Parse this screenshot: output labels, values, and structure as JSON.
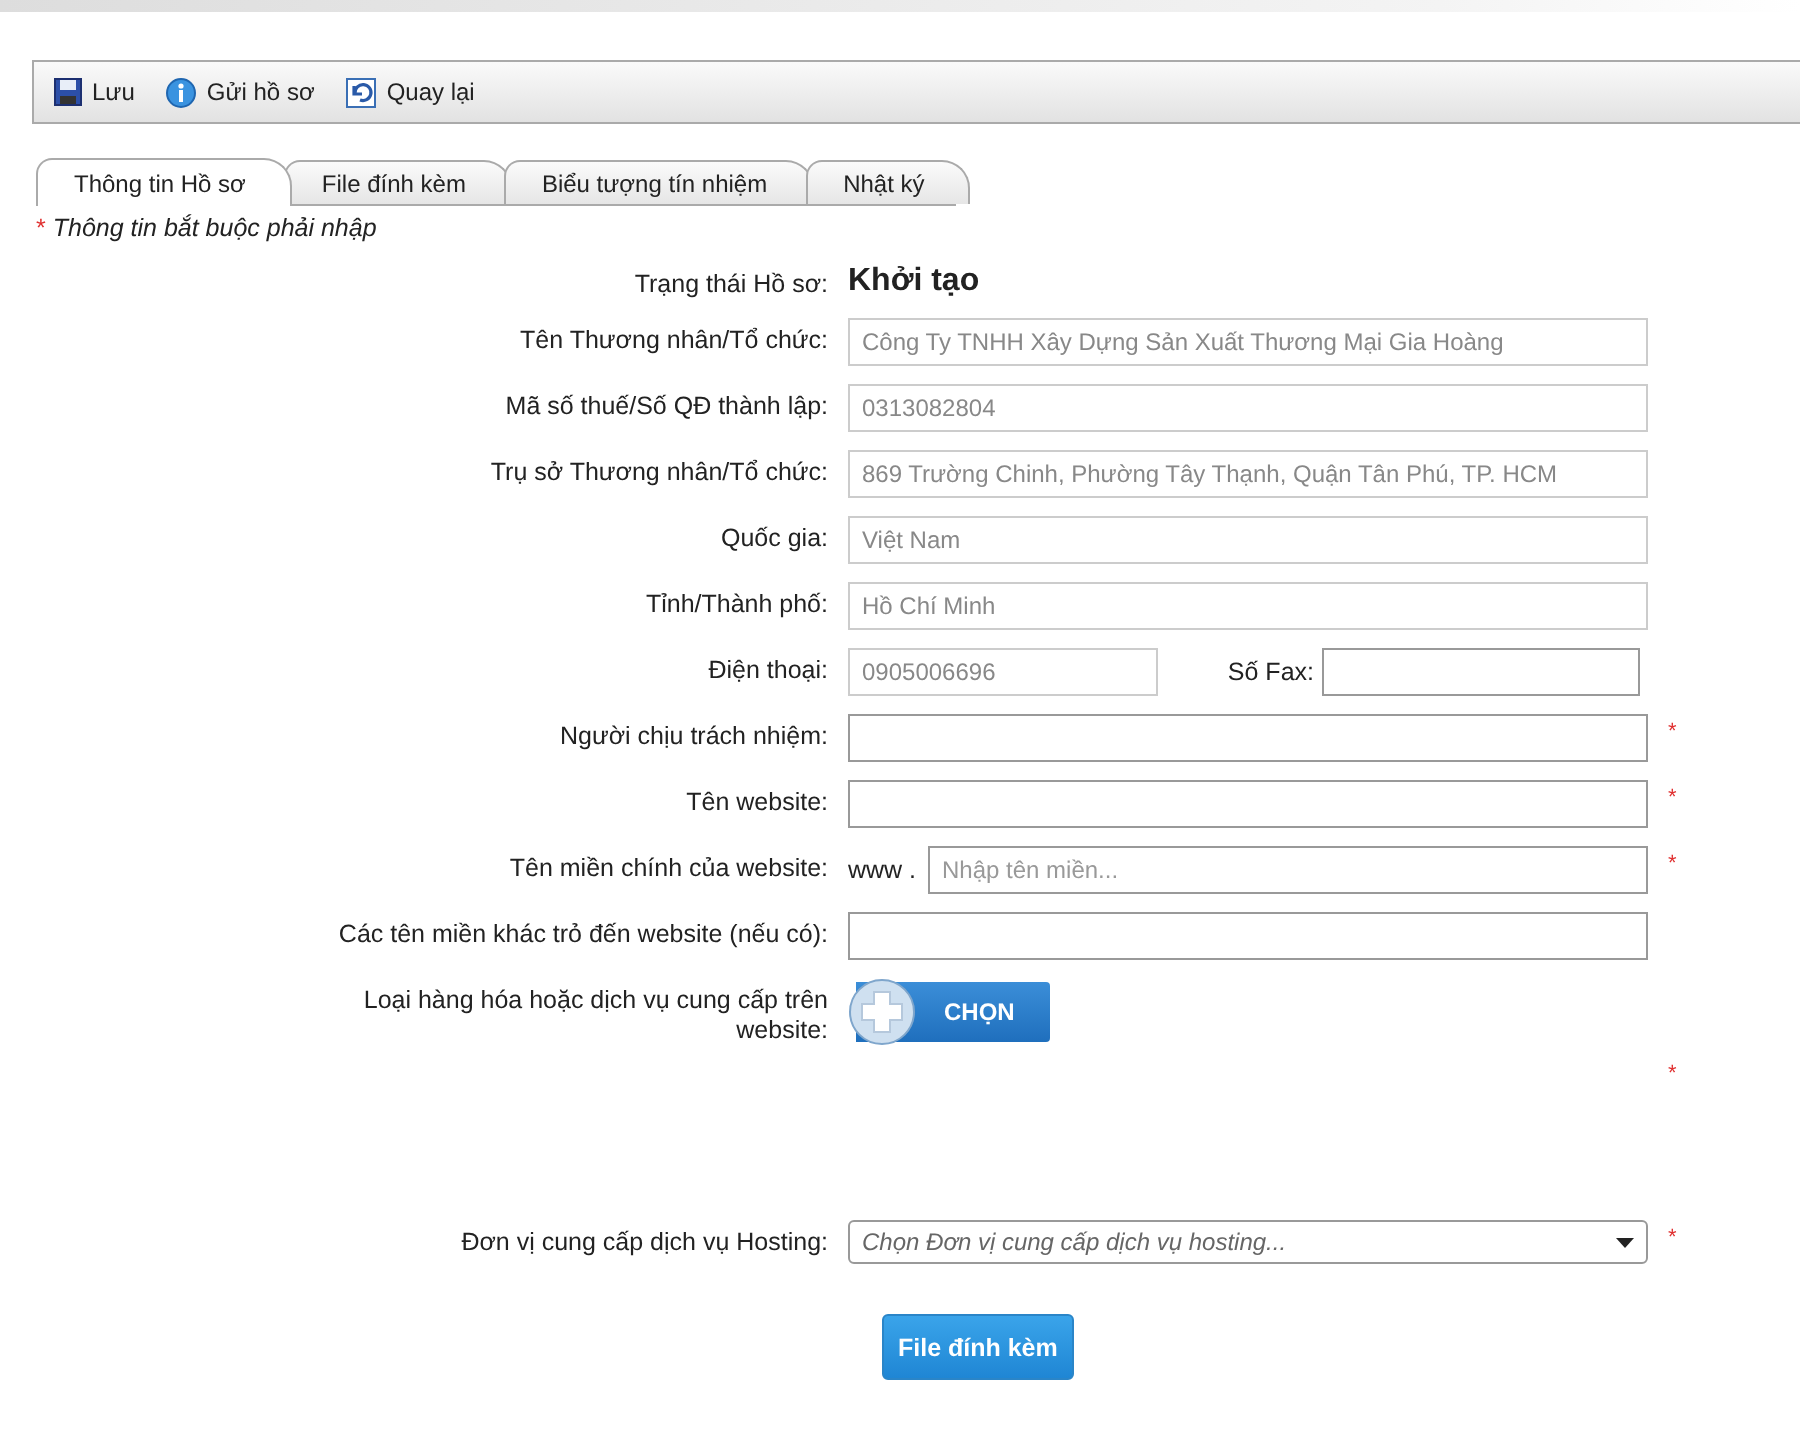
{
  "toolbar": [
    {
      "kind": "save",
      "label": "Lưu"
    },
    {
      "kind": "info",
      "label": "Gửi hồ sơ"
    },
    {
      "kind": "back",
      "label": "Quay lại"
    }
  ],
  "tabs": [
    {
      "label": "Thông tin Hồ sơ",
      "selected": true
    },
    {
      "label": "File đính kèm",
      "selected": false
    },
    {
      "label": "Biểu tượng tín nhiệm",
      "selected": false
    },
    {
      "label": "Nhật ký",
      "selected": false
    }
  ],
  "required_note": {
    "mark": "*",
    "text": "Thông tin bắt buộc phải nhập"
  },
  "fields": [
    {
      "kind": "status",
      "label": "Trạng thái Hồ sơ:",
      "value": "Khởi tạo",
      "required": false
    },
    {
      "kind": "text",
      "label": "Tên Thương nhân/Tổ chức:",
      "value": "Công Ty TNHH Xây Dựng Sản Xuất Thương Mại Gia Hoàng",
      "disabled": true,
      "required": false
    },
    {
      "kind": "text",
      "label": "Mã số thuế/Số QĐ thành lập:",
      "value": "0313082804",
      "disabled": true,
      "required": false
    },
    {
      "kind": "text",
      "label": "Trụ sở Thương nhân/Tổ chức:",
      "value": "869 Trường Chinh, Phường Tây Thạnh, Quận Tân Phú, TP. HCM",
      "disabled": true,
      "required": false
    },
    {
      "kind": "text",
      "label": "Quốc gia:",
      "value": "Việt Nam",
      "disabled": true,
      "required": false
    },
    {
      "kind": "text",
      "label": "Tỉnh/Thành phố:",
      "value": "Hồ Chí Minh",
      "disabled": true,
      "required": false
    },
    {
      "kind": "phone_fax",
      "label": "Điện thoại:",
      "value": "0905006696",
      "disabled": true,
      "fax_label": "Số Fax:",
      "required": false
    },
    {
      "kind": "text",
      "label": "Người chịu trách nhiệm:",
      "disabled": false,
      "required": true
    },
    {
      "kind": "text",
      "label": "Tên website:",
      "disabled": false,
      "required": true
    },
    {
      "kind": "domain",
      "label": "Tên miền chính của website:",
      "prefix": "www .",
      "placeholder": "Nhập tên miền...",
      "required": true
    },
    {
      "kind": "text",
      "label": "Các tên miền khác trỏ đến website (nếu có):",
      "disabled": false,
      "required": false
    },
    {
      "kind": "pick",
      "label": "Loại hàng hóa hoặc dịch vụ cung cấp trên website:",
      "button": "CHỌN",
      "required": true
    },
    {
      "kind": "select",
      "label": "Đơn vị cung cấp dịch vụ Hosting:",
      "placeholder": "Chọn Đơn vị cung cấp dịch vụ hosting...",
      "required": true
    }
  ],
  "submit": "File đính kèm"
}
